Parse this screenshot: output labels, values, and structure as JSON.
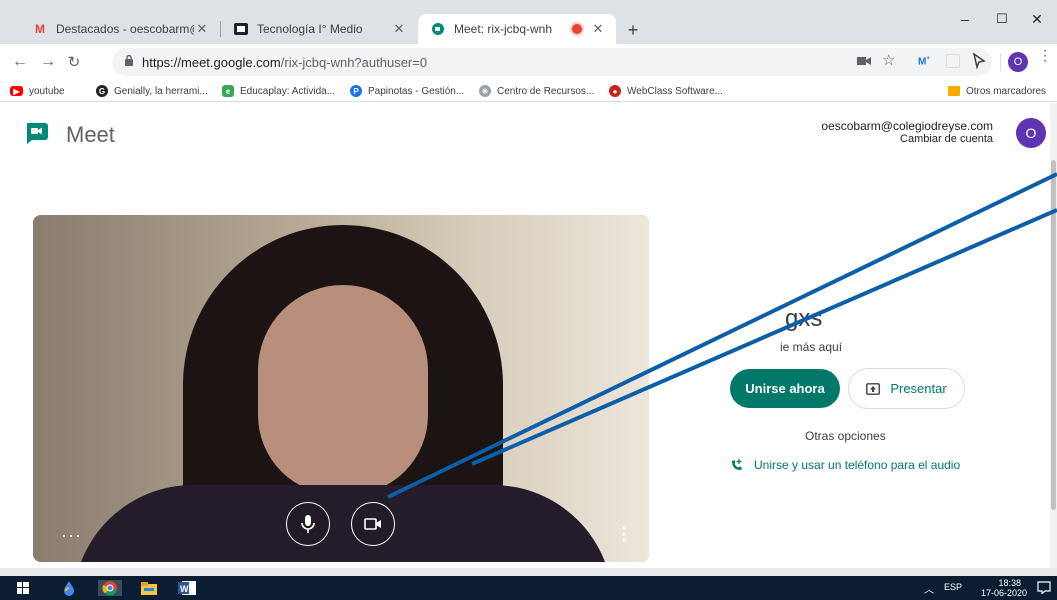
{
  "browser": {
    "tabs": [
      {
        "title": "Destacados - oescobarm@colegi",
        "favicon": "gmail-icon",
        "active": false
      },
      {
        "title": "Tecnología I° Medio",
        "favicon": "classroom-icon",
        "active": false
      },
      {
        "title": "Meet: rix-jcbq-wnh",
        "favicon": "meet-icon",
        "active": true,
        "recording": true
      }
    ],
    "new_tab_symbol": "+",
    "window_controls": {
      "minimize": "–",
      "maximize": "☐",
      "close": "✕"
    },
    "url_host": "https://meet.google.com",
    "url_path": "/rix-jcbq-wnh?authuser=0",
    "profile_initial": "O",
    "bookmarks": [
      {
        "label": "youtube",
        "icon": "youtube-icon",
        "color": "#ff0000"
      },
      {
        "label": "Genially, la herrami...",
        "icon": "genially-icon",
        "color": "#202124"
      },
      {
        "label": "Educaplay: Activida...",
        "icon": "educaplay-icon",
        "color": "#34a853"
      },
      {
        "label": "Papinotas - Gestión...",
        "icon": "papinotas-icon",
        "color": "#1a73e8"
      },
      {
        "label": "Centro de Recursos...",
        "icon": "recursos-icon",
        "color": "#9aa0a6"
      },
      {
        "label": "WebClass Software...",
        "icon": "webclass-icon",
        "color": "#c5221f"
      }
    ],
    "other_bookmarks": "Otros marcadores"
  },
  "meet": {
    "brand": "Meet",
    "account_email": "oescobarm@colegiodreyse.com",
    "switch_account": "Cambiar de cuenta",
    "avatar_initial": "O",
    "room_name": "gxs",
    "others_text": "ie más aquí",
    "join_label": "Unirse ahora",
    "present_label": "Presentar",
    "other_options": "Otras opciones",
    "phone_option": "Unirse y usar un teléfono para el audio",
    "colors": {
      "accent": "#00796b",
      "avatar": "#5e35b1",
      "annotation": "#0b5ea8"
    }
  },
  "taskbar": {
    "language": "ESP",
    "time": "18:38",
    "date": "17-06-2020"
  }
}
